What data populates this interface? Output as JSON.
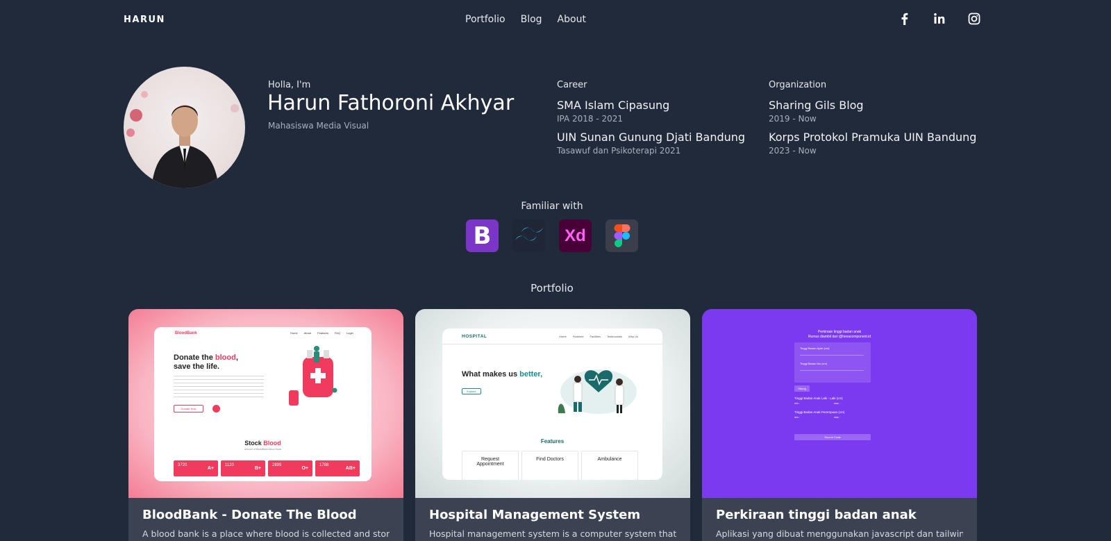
{
  "nav": {
    "brand": "HARUN",
    "links": [
      "Portfolio",
      "Blog",
      "About"
    ],
    "socials": [
      "facebook-icon",
      "linkedin-icon",
      "instagram-icon"
    ]
  },
  "profile": {
    "greeting": "Holla, I'm",
    "name": "Harun Fathoroni Akhyar",
    "role": "Mahasiswa Media Visual"
  },
  "career": {
    "heading": "Career",
    "items": [
      {
        "title": "SMA Islam Cipasung",
        "sub": "IPA 2018 - 2021"
      },
      {
        "title": "UIN Sunan Gunung Djati Bandung",
        "sub": "Tasawuf dan Psikoterapi 2021"
      }
    ]
  },
  "organization": {
    "heading": "Organization",
    "items": [
      {
        "title": "Sharing Gils Blog",
        "sub": "2019 - Now"
      },
      {
        "title": "Korps Protokol Pramuka UIN Bandung",
        "sub": "2023 - Now"
      }
    ]
  },
  "familiar": {
    "heading": "Familiar with",
    "tools": [
      {
        "icon": "bootstrap-icon",
        "glyph": "B",
        "bg": "#7a36c7",
        "fg": "#ffffff"
      },
      {
        "icon": "tailwind-icon",
        "glyph": "",
        "bg": "#1f2737",
        "fg": "#38bdf8"
      },
      {
        "icon": "adobe-xd-icon",
        "glyph": "Xd",
        "bg": "#470137",
        "fg": "#ff61f6"
      },
      {
        "icon": "figma-icon",
        "glyph": "",
        "bg": "#3a3f4b",
        "fg": "#ffffff"
      }
    ]
  },
  "portfolio": {
    "heading": "Portfolio",
    "cards": [
      {
        "title": "BloodBank - Donate The Blood",
        "desc": "A blood bank is a place where blood is collected and stored",
        "preview": {
          "brand": "BloodBank",
          "menu": [
            "Home",
            "About",
            "Features",
            "FAQ",
            "Login"
          ],
          "headline_1": "Donate the ",
          "headline_accent": "blood",
          "headline_2": "save the life.",
          "button": "Donate Now",
          "stock_title": "Stock ",
          "stock_accent": "Blood",
          "stock_sub": "Amount of BloodBank Blood Stock",
          "stocks": [
            {
              "value": "3720",
              "type": "A+"
            },
            {
              "value": "1120",
              "type": "B+"
            },
            {
              "value": "2899",
              "type": "O+"
            },
            {
              "value": "1788",
              "type": "AB+"
            }
          ]
        }
      },
      {
        "title": "Hospital Management System",
        "desc": "Hospital management system is a computer system that",
        "preview": {
          "brand": "HOSPITAL",
          "menu": [
            "Home",
            "Features",
            "Facilities",
            "Testimonials",
            "Why Us"
          ],
          "headline_1": "What makes us ",
          "headline_accent": "better,",
          "button": "Explore",
          "features_title": "Features",
          "features": [
            "Request Appointment",
            "Find Doctors",
            "Ambulance"
          ]
        }
      },
      {
        "title": "Perkiraan tinggi badan anak",
        "desc": "Aplikasi yang dibuat menggunakan javascript dan tailwind",
        "preview": {
          "heading": "Perkiraan tinggi badan anak",
          "sub": "Rumus diambil dari @hexacomponent.id",
          "field_1": "Tinggi Badan Ayah (cm)",
          "field_2": "Tinggi Badan Ibu (cm)",
          "button": "Hitung",
          "result_1": "Tinggi Badan Anak Laki - Laki (cm)",
          "result_2": "Tinggi Badan Anak Perempuan (cm)",
          "min_label": "min :",
          "max_label": "max :",
          "source": "Source Code"
        }
      }
    ]
  },
  "colors": {
    "background": "#212a3b",
    "card_footer": "#3b4353",
    "blood_accent": "#f03b5c",
    "hospital_accent": "#1a8c8c",
    "tinggi_bg": "#7b3af0"
  }
}
